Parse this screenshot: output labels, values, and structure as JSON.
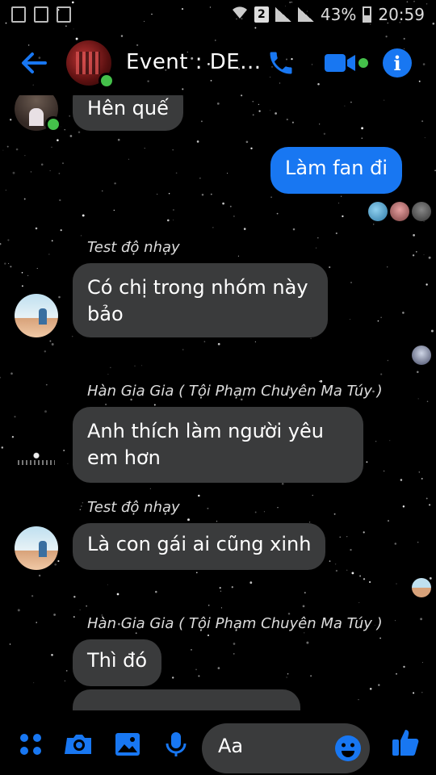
{
  "status_bar": {
    "sim_slot": "2",
    "battery": "43%",
    "time": "20:59"
  },
  "header": {
    "title": "Event : DE...",
    "icons": [
      "back-arrow-icon",
      "phone-icon",
      "video-camera-icon",
      "info-icon"
    ],
    "accent_color": "#1877f2",
    "online_color": "#44c04a"
  },
  "messages": [
    {
      "from": "other",
      "text": "Hên quế"
    },
    {
      "from": "me",
      "text": "Làm fan đi"
    },
    {
      "from": "other",
      "sender": "Test độ nhạy",
      "text": "Có chị trong nhóm này bảo"
    },
    {
      "from": "other",
      "sender": "Hàn Gia Gia ( Tội Phạm Chuyên Ma Túy )",
      "text": "Anh thích làm người yêu em hơn"
    },
    {
      "from": "other",
      "sender": "Test độ nhạy",
      "text": "Là con gái ai cũng xinh"
    },
    {
      "from": "other",
      "sender": "Hàn Gia Gia ( Tội Phạm Chuyên Ma Túy )",
      "text": "Thì đó"
    }
  ],
  "composer": {
    "placeholder": "Aa",
    "icons": [
      "more-apps-icon",
      "camera-icon",
      "gallery-icon",
      "microphone-icon",
      "emoji-icon",
      "like-icon"
    ]
  }
}
